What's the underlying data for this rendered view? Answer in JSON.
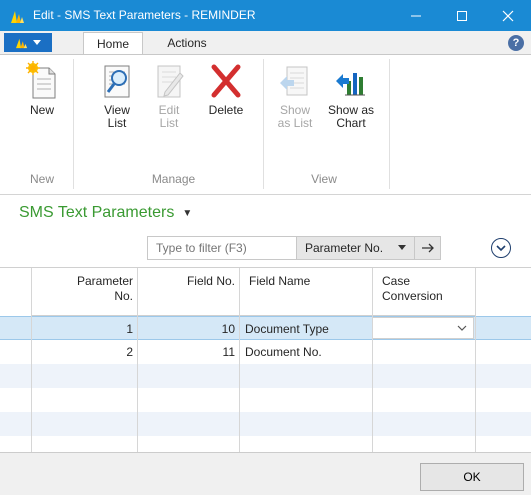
{
  "window": {
    "title": "Edit - SMS Text Parameters - REMINDER",
    "controls": [
      "minimize-icon",
      "maximize-icon",
      "close-icon"
    ]
  },
  "ribbon": {
    "tabs": [
      {
        "label": "Home",
        "active": true
      },
      {
        "label": "Actions",
        "active": false
      }
    ],
    "groups": [
      {
        "label": "New",
        "buttons": [
          {
            "label": "New",
            "icon": "new-document-icon",
            "enabled": true
          }
        ]
      },
      {
        "label": "Manage",
        "buttons": [
          {
            "line1": "View",
            "line2": "List",
            "icon": "view-list-icon",
            "enabled": true
          },
          {
            "line1": "Edit",
            "line2": "List",
            "icon": "edit-list-icon",
            "enabled": false
          },
          {
            "label": "Delete",
            "icon": "delete-icon",
            "enabled": true
          }
        ]
      },
      {
        "label": "View",
        "buttons": [
          {
            "line1": "Show",
            "line2": "as List",
            "icon": "show-as-list-icon",
            "enabled": false
          },
          {
            "line1": "Show as",
            "line2": "Chart",
            "icon": "show-as-chart-icon",
            "enabled": true
          }
        ]
      }
    ]
  },
  "page": {
    "title": "SMS Text Parameters"
  },
  "filter": {
    "placeholder": "Type to filter (F3)",
    "field": "Parameter No."
  },
  "table": {
    "headers": {
      "parameter_no_1": "Parameter",
      "parameter_no_2": "No.",
      "field_no": "Field No.",
      "field_name": "Field Name",
      "case_1": "Case",
      "case_2": "Conversion"
    },
    "rows": [
      {
        "parameter_no": "1",
        "field_no": "10",
        "field_name": "Document Type",
        "case_conversion": ""
      },
      {
        "parameter_no": "2",
        "field_no": "11",
        "field_name": "Document No.",
        "case_conversion": ""
      }
    ]
  },
  "footer": {
    "ok_label": "OK"
  },
  "colors": {
    "titlebar": "#1a8ad4",
    "page_title": "#3a9a32",
    "selected_row": "#d5e8f7"
  }
}
